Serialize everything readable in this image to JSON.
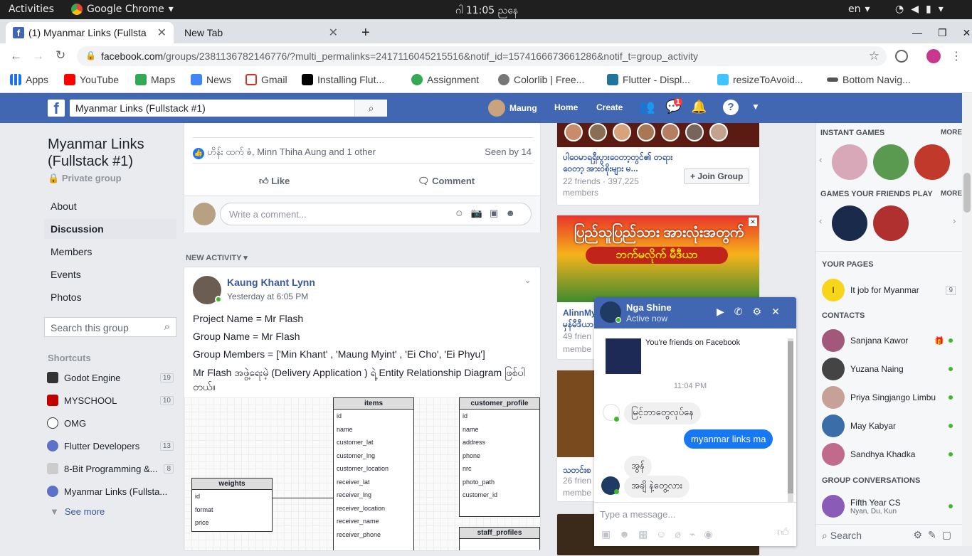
{
  "os": {
    "activities": "Activities",
    "app": "Google Chrome",
    "clock": "ဂါ 11:05 ညနေ",
    "lang": "en"
  },
  "tabs": [
    {
      "label": "(1) Myanmar Links (Fullsta"
    },
    {
      "label": "New Tab"
    }
  ],
  "url": {
    "domain": "facebook.com",
    "path": "/groups/2381136782146776/?multi_permalinks=2417116045215516&notif_id=1574166673661286&notif_t=group_activity"
  },
  "bookmarks": [
    {
      "label": "Apps",
      "color": "#1a73e8"
    },
    {
      "label": "YouTube",
      "color": "#ff0000"
    },
    {
      "label": "Maps",
      "color": "#34a853"
    },
    {
      "label": "News",
      "color": "#4285f4"
    },
    {
      "label": "Gmail",
      "color": "#d93025"
    },
    {
      "label": "Installing Flut...",
      "color": "#000000"
    },
    {
      "label": "Assignment",
      "color": "#34a853"
    },
    {
      "label": "Colorlib | Free...",
      "color": "#777777"
    },
    {
      "label": "Flutter - Displ...",
      "color": "#21759b"
    },
    {
      "label": "resizeToAvoid...",
      "color": "#40c4ff"
    },
    {
      "label": "Bottom Navig...",
      "color": "#555555"
    }
  ],
  "fb": {
    "search_value": "Myanmar Links (Fullstack #1)",
    "user": "Maung",
    "home": "Home",
    "create": "Create",
    "messages_badge": "1",
    "brand_color": "#4267b2"
  },
  "group": {
    "name": "Myanmar Links (Fullstack #1)",
    "privacy": "Private group",
    "menu": [
      "About",
      "Discussion",
      "Members",
      "Events",
      "Photos"
    ],
    "search_placeholder": "Search this group",
    "shortcuts_title": "Shortcuts",
    "shortcuts": [
      {
        "label": "Godot Engine",
        "count": "19",
        "color": "#333333"
      },
      {
        "label": "MYSCHOOL",
        "count": "10",
        "color": "#c00000"
      },
      {
        "label": "OMG",
        "count": "",
        "color": "#ffffff"
      },
      {
        "label": "Flutter Developers",
        "count": "13",
        "color": "#5b72c8"
      },
      {
        "label": "8-Bit Programming &...",
        "count": "8",
        "color": "#cccccc"
      },
      {
        "label": "Myanmar Links (Fullsta...",
        "count": "",
        "color": "#5b72c8"
      }
    ],
    "see_more": "See more"
  },
  "post1": {
    "reactions": "ဟိန်း ထက် ဇံ, Minn Thiha Aung and 1 other",
    "seen": "Seen by 14",
    "like": "Like",
    "comment": "Comment",
    "comment_placeholder": "Write a comment..."
  },
  "activity_label": "NEW ACTIVITY",
  "post2": {
    "author": "Kaung Khant Lynn",
    "time": "Yesterday at 6:05 PM",
    "lines": [
      "Project Name = Mr Flash",
      "Group Name = Mr Flash",
      "Group Members = ['Min Khant' , 'Maung Myint' , 'Ei Cho', 'Ei Phyu']",
      "Mr Flash အဖွဲ့ရေးမဲ့ (Delivery Application ) ရဲ့ Entity Relationship Diagram ဖြစ်ပါတယ်။"
    ],
    "tables": {
      "items": {
        "title": "items",
        "fields": [
          "id",
          "name",
          "customer_lat",
          "customer_lng",
          "customer_location",
          "receiver_lat",
          "receiver_lng",
          "receiver_location",
          "receiver_name",
          "receiver_phone"
        ]
      },
      "customer_profile": {
        "title": "customer_profile",
        "fields": [
          "id",
          "name",
          "address",
          "phone",
          "nrc",
          "photo_path",
          "customer_id"
        ]
      },
      "weights": {
        "title": "weights",
        "fields": [
          "id",
          "format",
          "price"
        ]
      },
      "staff_profiles": {
        "title": "staff_profiles",
        "fields": []
      }
    }
  },
  "ads": {
    "group1_title": "ပါဝေမာရရှီးပွားဝေတာ့တွင်၏ တရား ဝေတာ့ အားဝဲစိုးများ မ...",
    "group1_stats": "22 friends · 397,225 members",
    "join": "Join Group",
    "banner_text1": "ပြည်သူပြည်သား အားလုံးအတွက်",
    "banner_text2": "ဘက်မလိုက် မီဒီယာ",
    "ad2_title": "AlinnMy",
    "ad2_sub": "မှန်မီဒီယာ",
    "ad2_stats1": "49 frien",
    "ad2_stats2": "membe",
    "ad3_title": "သတင်းစ",
    "ad3_stats1": "26 frien",
    "ad3_stats2": "membe"
  },
  "sidebar": {
    "instant_games": "INSTANT GAMES",
    "more": "MORE",
    "friends_games": "GAMES YOUR FRIENDS PLAY",
    "your_pages": "YOUR PAGES",
    "page_name": "It job for Myanmar",
    "page_count": "9",
    "contacts_title": "CONTACTS",
    "contacts": [
      {
        "name": "Sanjana Kawor",
        "color": "#a2587a"
      },
      {
        "name": "Yuzana Naing",
        "color": "#444444"
      },
      {
        "name": "Priya Singjango Limbu",
        "color": "#c7a197"
      },
      {
        "name": "May Kabyar",
        "color": "#3b6ea8"
      },
      {
        "name": "Sandhya Khadka",
        "color": "#c06a8c"
      }
    ],
    "group_conv_title": "GROUP CONVERSATIONS",
    "group_conv_name": "Fifth Year CS",
    "group_conv_members": "Nyan, Du, Kun",
    "search_placeholder": "Search"
  },
  "chat": {
    "name": "Nga Shine",
    "status": "Active now",
    "friends_note": "You're friends on Facebook",
    "time": "11:04 PM",
    "msgs": [
      {
        "text": "မြင့်ဘာတွေလုပ်နေ",
        "mine": false
      },
      {
        "text": "myanmar links ma",
        "mine": true
      },
      {
        "text": "အွန်",
        "mine": false
      },
      {
        "text": "အချိ နဲ့တွေ့လား",
        "mine": false
      }
    ],
    "input_placeholder": "Type a message...",
    "accent": "#1877f2"
  }
}
